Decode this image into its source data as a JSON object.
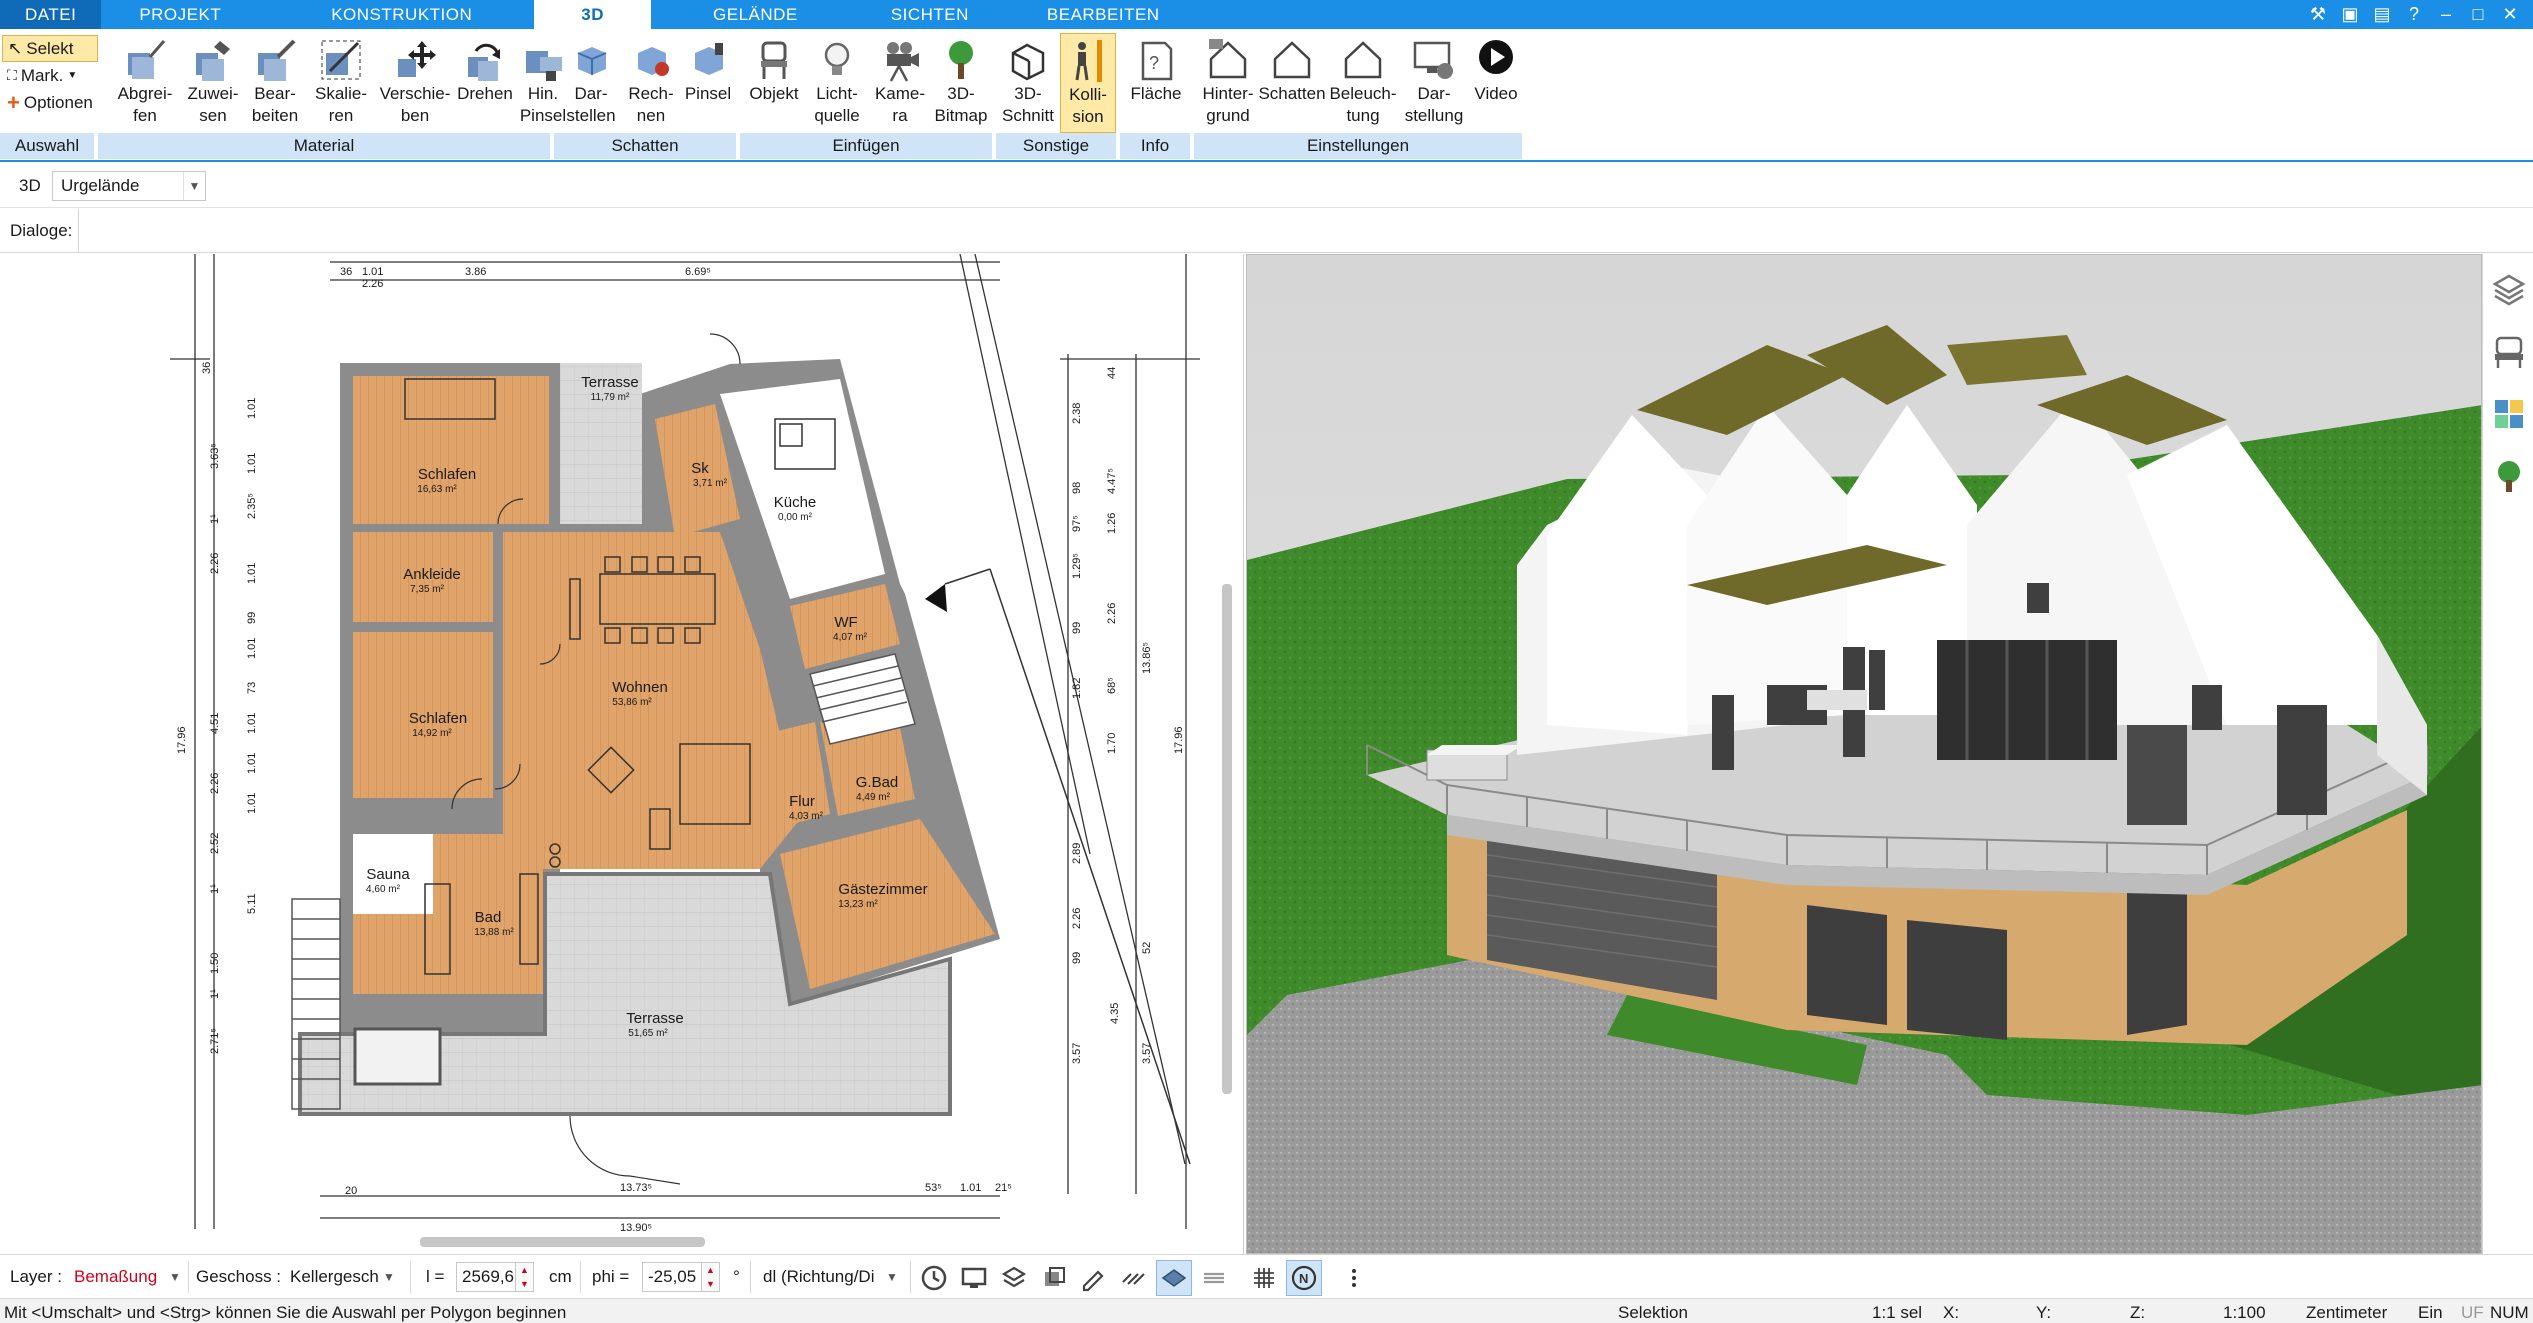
{
  "tabs": {
    "file": "DATEI",
    "items": [
      "PROJEKT",
      "KONSTRUKTION",
      "3D",
      "GELÄNDE",
      "SICHTEN",
      "BEARBEITEN"
    ],
    "active": "3D"
  },
  "window_controls": [
    "tools-icon",
    "restore-icon",
    "window-icon",
    "help-icon",
    "minimize-icon",
    "maximize-icon",
    "close-icon"
  ],
  "ribbon": {
    "auswahl": {
      "label": "Auswahl",
      "selekt": "Selekt",
      "mark": "Mark.",
      "optionen": "Optionen"
    },
    "material": {
      "label": "Material",
      "buttons": [
        "Abgrei-\nfen",
        "Zuwei-\nsen",
        "Bear-\nbeiten",
        "Skalie-\nren",
        "Verschie-\nben",
        "Drehen",
        "Hin.\nPinsel"
      ]
    },
    "schatten": {
      "label": "Schatten",
      "buttons": [
        "Dar-\nstellen",
        "Rech-\nnen",
        "Pinsel"
      ]
    },
    "einfuegen": {
      "label": "Einfügen",
      "buttons": [
        "Objekt",
        "Licht-\nquelle",
        "Kame-\nra",
        "3D-\nBitmap"
      ]
    },
    "sonstige": {
      "label": "Sonstige",
      "buttons": [
        "3D-\nSchnitt",
        "Kolli-\nsion"
      ]
    },
    "info": {
      "label": "Info",
      "buttons": [
        "Fläche"
      ]
    },
    "einstellungen": {
      "label": "Einstellungen",
      "buttons": [
        "Hinter-\ngrund",
        "Schatten",
        "Beleuch-\ntung",
        "Dar-\nstellung",
        "Video"
      ]
    }
  },
  "toolbar2": {
    "mode": "3D",
    "combo": "Urgelände"
  },
  "toolbar3": {
    "label": "Dialoge:"
  },
  "plan": {
    "rooms": [
      {
        "name": "Terrasse",
        "area": "11,79 m²"
      },
      {
        "name": "Sk",
        "area": "3,71 m²"
      },
      {
        "name": "Küche",
        "area": "0,00 m²"
      },
      {
        "name": "Schlafen",
        "area": "16,63 m²"
      },
      {
        "name": "Ankleide",
        "area": "7,35 m²"
      },
      {
        "name": "WF",
        "area": "4,07 m²"
      },
      {
        "name": "Wohnen",
        "area": "53,86 m²"
      },
      {
        "name": "Schlafen",
        "area": "14,92 m²"
      },
      {
        "name": "G.Bad",
        "area": "4,49 m²"
      },
      {
        "name": "Flur",
        "area": "4,03 m²"
      },
      {
        "name": "Sauna",
        "area": "4,60 m²"
      },
      {
        "name": "Gästezimmer",
        "area": "13,23 m²"
      },
      {
        "name": "Bad",
        "area": "13,88 m²"
      },
      {
        "name": "Terrasse",
        "area": "51,65 m²"
      }
    ],
    "dims_top": [
      "36",
      "1.01",
      "2.26",
      "3.86",
      "6.69⁵"
    ],
    "dims_left": [
      "36",
      "1.01",
      "3.63⁵",
      "1.01",
      "2.35⁵",
      "1¹",
      "2.26",
      "1.01",
      "99",
      "1.01",
      "73",
      "1.01",
      "4.51",
      "1.01",
      "2.26",
      "1.01",
      "2.52",
      "1¹",
      "5.11",
      "1.50",
      "1¹",
      "2.71⁵",
      "17.96"
    ],
    "dims_right": [
      "44",
      "2.38",
      "4.47⁵",
      "98",
      "97⁵",
      "1.26",
      "1.29⁵",
      "2.26",
      "99",
      "13.86⁵",
      "1.82",
      "68⁵",
      "1.70",
      "17.96",
      "2.89",
      "2.26",
      "99",
      "52",
      "3.57",
      "4.35",
      "3.57"
    ],
    "dims_bottom": [
      "20",
      "13.73⁵",
      "13.90⁵",
      "53⁵",
      "1.01",
      "21⁵"
    ]
  },
  "bottom_bar": {
    "layer_label": "Layer :",
    "layer_value": "Bemaßung",
    "geschoss_label": "Geschoss :",
    "geschoss_value": "Kellergesch",
    "l_label": "l =",
    "l_value": "2569,6",
    "l_unit": "cm",
    "phi_label": "phi =",
    "phi_value": "-25,05",
    "phi_unit": "°",
    "dl_value": "dl (Richtung/Di",
    "tool_icons": [
      "clock-icon",
      "monitor-icon",
      "layers-icon",
      "stamp-icon",
      "pencil-icon",
      "hatch-icon",
      "diamond-icon",
      "stack-icon",
      "grid-icon",
      "snap-icon",
      "more-icon"
    ]
  },
  "status_bar": {
    "hint": "Mit <Umschalt> und <Strg> können Sie die Auswahl per Polygon beginnen",
    "mode": "Selektion",
    "sel": "1:1 sel",
    "x": "X:",
    "y": "Y:",
    "z": "Z:",
    "scale": "1:100",
    "unit": "Zentimeter",
    "ein": "Ein",
    "uf": "UF",
    "num": "NUM"
  },
  "colors": {
    "accent": "#1b8fe6",
    "floor": "#e0a36a",
    "wall": "#9a9a9a",
    "grass": "#3f8a2a",
    "measure_red": "#d0021b"
  }
}
